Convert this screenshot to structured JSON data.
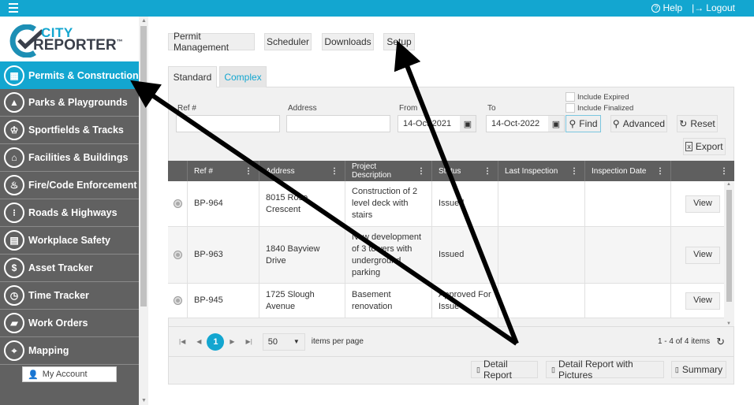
{
  "topbar": {
    "menu_icon": "hamburger-icon",
    "help": "Help",
    "logout": "Logout"
  },
  "logo": {
    "line1": "CITY",
    "line2": "REPORTER",
    "tm": "™"
  },
  "sidebar": {
    "items": [
      {
        "label": "Permits & Construction",
        "icon": "building-icon",
        "active": true
      },
      {
        "label": "Parks & Playgrounds",
        "icon": "tree-icon"
      },
      {
        "label": "Sportfields & Tracks",
        "icon": "trophy-icon"
      },
      {
        "label": "Facilities & Buildings",
        "icon": "facility-icon"
      },
      {
        "label": "Fire/Code Enforcement",
        "icon": "extinguisher-icon"
      },
      {
        "label": "Roads & Highways",
        "icon": "traffic-light-icon"
      },
      {
        "label": "Workplace Safety",
        "icon": "id-badge-icon"
      },
      {
        "label": "Asset Tracker",
        "icon": "dollar-hand-icon"
      },
      {
        "label": "Time Tracker",
        "icon": "clock-icon"
      },
      {
        "label": "Work Orders",
        "icon": "work-order-icon"
      },
      {
        "label": "Mapping",
        "icon": "map-icon"
      }
    ],
    "account": "My Account"
  },
  "toolbar": {
    "permit_management": "Permit Management",
    "scheduler": "Scheduler",
    "downloads": "Downloads",
    "setup": "Setup"
  },
  "tabs": {
    "standard": "Standard",
    "complex": "Complex"
  },
  "filters": {
    "ref_label": "Ref #",
    "ref_value": "",
    "address_label": "Address",
    "address_value": "",
    "from_label": "From",
    "from_value": "14-Oct-2021",
    "to_label": "To",
    "to_value": "14-Oct-2022",
    "include_expired": "Include Expired",
    "include_finalized": "Include Finalized",
    "find": "Find",
    "advanced": "Advanced",
    "reset": "Reset",
    "export": "Export"
  },
  "grid": {
    "columns": [
      "Ref #",
      "Address",
      "Project Description",
      "Status",
      "Last Inspection",
      "Inspection Date",
      ""
    ],
    "rows": [
      {
        "ref": "BP-964",
        "address": "8015 Rose Crescent",
        "description": "Construction of 2 level deck with stairs",
        "status": "Issued",
        "last_inspection": "",
        "inspection_date": "",
        "action": "View"
      },
      {
        "ref": "BP-963",
        "address": "1840 Bayview Drive",
        "description": "New development of 3 towers with underground parking",
        "status": "Issued",
        "last_inspection": "",
        "inspection_date": "",
        "action": "View"
      },
      {
        "ref": "BP-945",
        "address": "1725 Slough Avenue",
        "description": "Basement renovation",
        "status": "Approved For Issue",
        "last_inspection": "",
        "inspection_date": "",
        "action": "View"
      }
    ]
  },
  "pager": {
    "current_page": "1",
    "page_size": "50",
    "items_per_page": "items per page",
    "summary": "1 - 4 of 4 items"
  },
  "reports": {
    "detail": "Detail Report",
    "detail_pictures": "Detail Report with Pictures",
    "summary": "Summary"
  },
  "colors": {
    "accent": "#13a6d0",
    "sidebar": "#616161",
    "grid_header": "#5f5f5f"
  }
}
